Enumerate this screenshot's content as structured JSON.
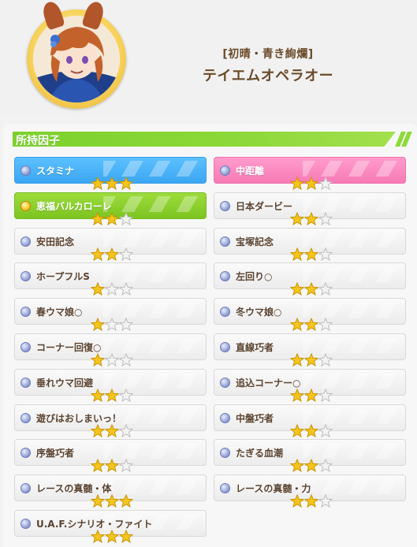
{
  "header": {
    "subtitle": "[初晴・青き絢爛]",
    "name": "テイエムオペラオー"
  },
  "section": {
    "title": "所持因子"
  },
  "colors": {
    "blue": "#3aa6f2",
    "pink": "#f77ab6",
    "green": "#7cc421",
    "star_on": "#f5c51d",
    "star_off": "#d8d8d8",
    "text_brown": "#5b4330"
  },
  "factors": [
    {
      "name": "スタミナ",
      "stars": 3,
      "kind": "blue",
      "dot": "gem"
    },
    {
      "name": "中距離",
      "stars": 2,
      "kind": "pink",
      "dot": "gem"
    },
    {
      "name": "恵福バルカローレ",
      "stars": 2,
      "kind": "green",
      "dot": "gold"
    },
    {
      "name": "日本ダービー",
      "stars": 2,
      "kind": "white",
      "dot": "gem"
    },
    {
      "name": "安田記念",
      "stars": 2,
      "kind": "white",
      "dot": "gem"
    },
    {
      "name": "宝塚記念",
      "stars": 2,
      "kind": "white",
      "dot": "gem"
    },
    {
      "name": "ホープフルS",
      "stars": 1,
      "kind": "white",
      "dot": "gem"
    },
    {
      "name": "左回り○",
      "stars": 2,
      "kind": "white",
      "dot": "gem"
    },
    {
      "name": "春ウマ娘○",
      "stars": 1,
      "kind": "white",
      "dot": "gem"
    },
    {
      "name": "冬ウマ娘○",
      "stars": 2,
      "kind": "white",
      "dot": "gem"
    },
    {
      "name": "コーナー回復○",
      "stars": 1,
      "kind": "white",
      "dot": "gem"
    },
    {
      "name": "直線巧者",
      "stars": 2,
      "kind": "white",
      "dot": "gem"
    },
    {
      "name": "垂れウマ回避",
      "stars": 2,
      "kind": "white",
      "dot": "gem"
    },
    {
      "name": "追込コーナー○",
      "stars": 2,
      "kind": "white",
      "dot": "gem"
    },
    {
      "name": "遊びはおしまいっ！",
      "stars": 2,
      "kind": "white",
      "dot": "gem"
    },
    {
      "name": "中盤巧者",
      "stars": 2,
      "kind": "white",
      "dot": "gem"
    },
    {
      "name": "序盤巧者",
      "stars": 2,
      "kind": "white",
      "dot": "gem"
    },
    {
      "name": "たぎる血潮",
      "stars": 2,
      "kind": "white",
      "dot": "gem"
    },
    {
      "name": "レースの真髄・体",
      "stars": 3,
      "kind": "white",
      "dot": "gem"
    },
    {
      "name": "レースの真髄・力",
      "stars": 2,
      "kind": "white",
      "dot": "gem"
    },
    {
      "name": "U.A.F.シナリオ・ファイト",
      "stars": 3,
      "kind": "white",
      "dot": "gem"
    }
  ]
}
